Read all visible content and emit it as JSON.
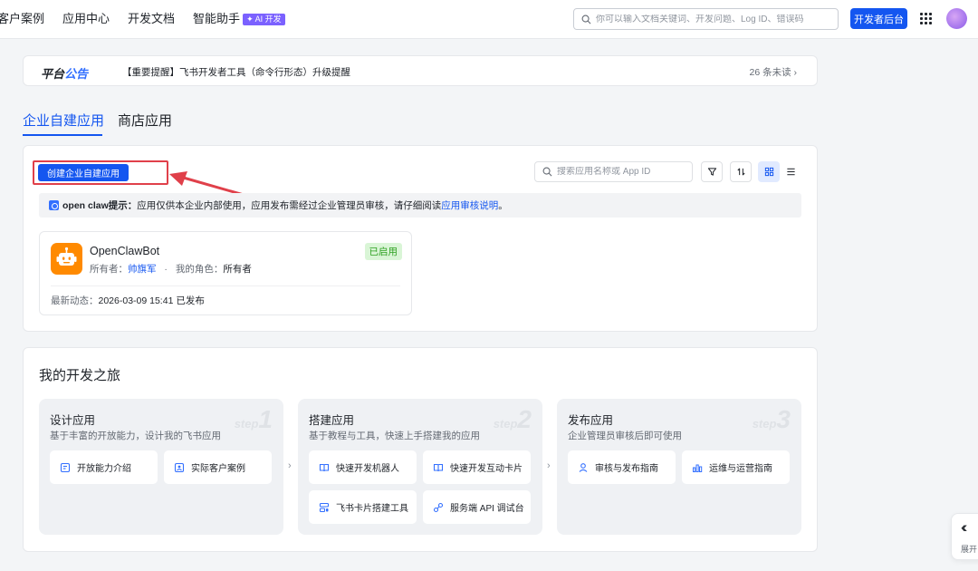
{
  "nav": {
    "items": [
      "客户案例",
      "应用中心",
      "开发文档",
      "智能助手"
    ],
    "ai_badge": "✦ AI 开发",
    "search_placeholder": "你可以输入文档关键词、开发问题、Log ID、错误码",
    "console_button": "开发者后台"
  },
  "announcement": {
    "logo_a": "平台",
    "logo_b": "公告",
    "text": "【重要提醒】飞书开发者工具（命令行形态）升级提醒",
    "count": "26 条未读 ›"
  },
  "tabs": [
    "企业自建应用",
    "商店应用"
  ],
  "apps": {
    "create_button": "创建企业自建应用",
    "search_placeholder": "搜索应用名称或 App ID",
    "notice": {
      "label": "open claw提示：",
      "text": "应用仅供本企业内部使用，应用发布需经过企业管理员审核，请仔细阅读 ",
      "link": "应用审核说明",
      "end": "。"
    },
    "card": {
      "name": "OpenClawBot",
      "status": "已启用",
      "owner_label": "所有者：",
      "owner": "帅旗军",
      "dot": "·",
      "role_label": "我的角色：",
      "role": "所有者",
      "update_label": "最新动态：",
      "update": "2026-03-09 15:41 已发布"
    }
  },
  "journey": {
    "title": "我的开发之旅",
    "steps": [
      {
        "title": "设计应用",
        "desc": "基于丰富的开放能力，设计我的飞书应用",
        "word": "step",
        "num": "1",
        "buttons": [
          "开放能力介绍",
          "实际客户案例"
        ]
      },
      {
        "title": "搭建应用",
        "desc": "基于教程与工具，快速上手搭建我的应用",
        "word": "step",
        "num": "2",
        "buttons": [
          "快速开发机器人",
          "快速开发互动卡片",
          "飞书卡片搭建工具",
          "服务端 API 调试台"
        ]
      },
      {
        "title": "发布应用",
        "desc": "企业管理员审核后即可使用",
        "word": "step",
        "num": "3",
        "buttons": [
          "审核与发布指南",
          "运维与运营指南"
        ]
      }
    ],
    "separator": "›"
  },
  "expand": {
    "chevrons": "‹‹",
    "label": "展开"
  },
  "colors": {
    "primary": "#1456f0",
    "highlight_red": "#e0404a",
    "app_icon": "#ff8a00",
    "status_green": "#2ea121"
  }
}
